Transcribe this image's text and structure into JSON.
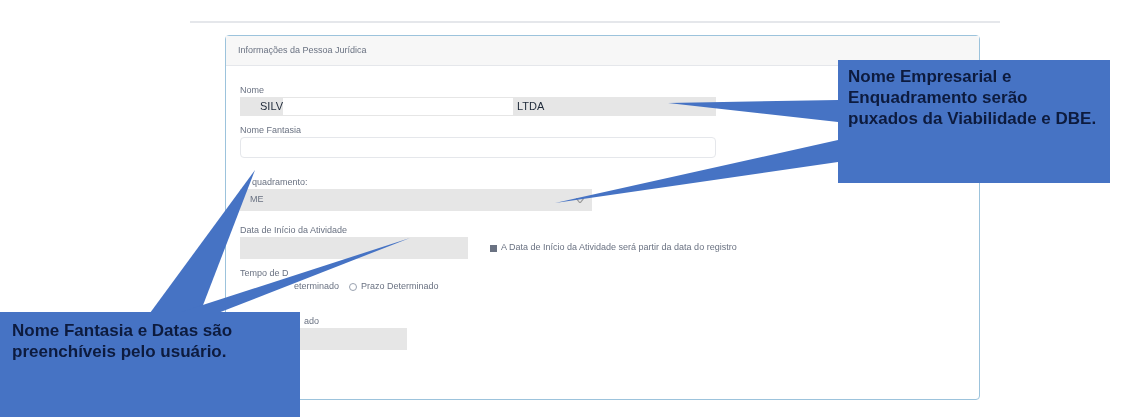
{
  "panel": {
    "title": "Informações da Pessoa Jurídica"
  },
  "fields": [
    {
      "kind": "redacted",
      "label": "Nome",
      "value_start": "SILV",
      "value_end": "LTDA"
    },
    {
      "kind": "text",
      "label": "Nome Fantasia"
    },
    {
      "kind": "select",
      "label": "quadramento:",
      "value": "ME"
    },
    {
      "kind": "date",
      "label": "Data de Início da Atividade",
      "checkbox": {
        "label": "A Data de Início da Atividade será partir da data do registro",
        "checked": true
      }
    },
    {
      "kind": "radio",
      "label": "Tempo de D",
      "options": [
        {
          "label": "eterminado",
          "selected": false
        },
        {
          "label": "Prazo Determinado",
          "selected": false
        }
      ]
    },
    {
      "kind": "short",
      "label": "ado"
    }
  ],
  "callouts": [
    {
      "text": "Nome Empresarial e Enquadramento serão puxados da Viabilidade e DBE."
    },
    {
      "text": "Nome Fantasia e Datas são preenchíveis pelo usuário."
    }
  ]
}
